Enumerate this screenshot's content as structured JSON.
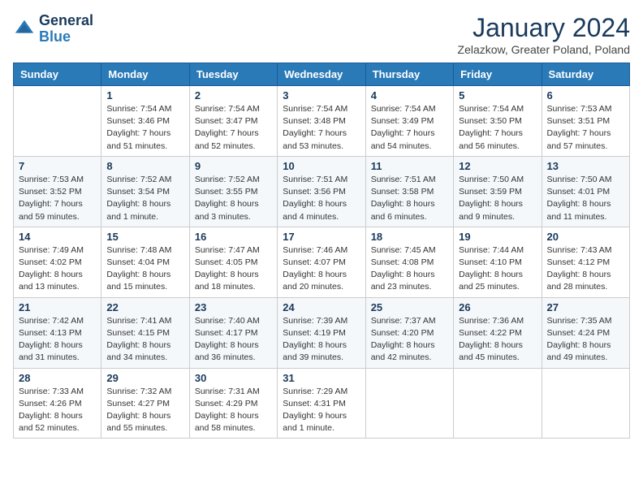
{
  "header": {
    "logo_general": "General",
    "logo_blue": "Blue",
    "month_title": "January 2024",
    "subtitle": "Zelazkow, Greater Poland, Poland"
  },
  "weekdays": [
    "Sunday",
    "Monday",
    "Tuesday",
    "Wednesday",
    "Thursday",
    "Friday",
    "Saturday"
  ],
  "weeks": [
    [
      {
        "day": null
      },
      {
        "day": 1,
        "sunrise": "7:54 AM",
        "sunset": "3:46 PM",
        "daylight": "7 hours and 51 minutes."
      },
      {
        "day": 2,
        "sunrise": "7:54 AM",
        "sunset": "3:47 PM",
        "daylight": "7 hours and 52 minutes."
      },
      {
        "day": 3,
        "sunrise": "7:54 AM",
        "sunset": "3:48 PM",
        "daylight": "7 hours and 53 minutes."
      },
      {
        "day": 4,
        "sunrise": "7:54 AM",
        "sunset": "3:49 PM",
        "daylight": "7 hours and 54 minutes."
      },
      {
        "day": 5,
        "sunrise": "7:54 AM",
        "sunset": "3:50 PM",
        "daylight": "7 hours and 56 minutes."
      },
      {
        "day": 6,
        "sunrise": "7:53 AM",
        "sunset": "3:51 PM",
        "daylight": "7 hours and 57 minutes."
      }
    ],
    [
      {
        "day": 7,
        "sunrise": "7:53 AM",
        "sunset": "3:52 PM",
        "daylight": "7 hours and 59 minutes."
      },
      {
        "day": 8,
        "sunrise": "7:52 AM",
        "sunset": "3:54 PM",
        "daylight": "8 hours and 1 minute."
      },
      {
        "day": 9,
        "sunrise": "7:52 AM",
        "sunset": "3:55 PM",
        "daylight": "8 hours and 3 minutes."
      },
      {
        "day": 10,
        "sunrise": "7:51 AM",
        "sunset": "3:56 PM",
        "daylight": "8 hours and 4 minutes."
      },
      {
        "day": 11,
        "sunrise": "7:51 AM",
        "sunset": "3:58 PM",
        "daylight": "8 hours and 6 minutes."
      },
      {
        "day": 12,
        "sunrise": "7:50 AM",
        "sunset": "3:59 PM",
        "daylight": "8 hours and 9 minutes."
      },
      {
        "day": 13,
        "sunrise": "7:50 AM",
        "sunset": "4:01 PM",
        "daylight": "8 hours and 11 minutes."
      }
    ],
    [
      {
        "day": 14,
        "sunrise": "7:49 AM",
        "sunset": "4:02 PM",
        "daylight": "8 hours and 13 minutes."
      },
      {
        "day": 15,
        "sunrise": "7:48 AM",
        "sunset": "4:04 PM",
        "daylight": "8 hours and 15 minutes."
      },
      {
        "day": 16,
        "sunrise": "7:47 AM",
        "sunset": "4:05 PM",
        "daylight": "8 hours and 18 minutes."
      },
      {
        "day": 17,
        "sunrise": "7:46 AM",
        "sunset": "4:07 PM",
        "daylight": "8 hours and 20 minutes."
      },
      {
        "day": 18,
        "sunrise": "7:45 AM",
        "sunset": "4:08 PM",
        "daylight": "8 hours and 23 minutes."
      },
      {
        "day": 19,
        "sunrise": "7:44 AM",
        "sunset": "4:10 PM",
        "daylight": "8 hours and 25 minutes."
      },
      {
        "day": 20,
        "sunrise": "7:43 AM",
        "sunset": "4:12 PM",
        "daylight": "8 hours and 28 minutes."
      }
    ],
    [
      {
        "day": 21,
        "sunrise": "7:42 AM",
        "sunset": "4:13 PM",
        "daylight": "8 hours and 31 minutes."
      },
      {
        "day": 22,
        "sunrise": "7:41 AM",
        "sunset": "4:15 PM",
        "daylight": "8 hours and 34 minutes."
      },
      {
        "day": 23,
        "sunrise": "7:40 AM",
        "sunset": "4:17 PM",
        "daylight": "8 hours and 36 minutes."
      },
      {
        "day": 24,
        "sunrise": "7:39 AM",
        "sunset": "4:19 PM",
        "daylight": "8 hours and 39 minutes."
      },
      {
        "day": 25,
        "sunrise": "7:37 AM",
        "sunset": "4:20 PM",
        "daylight": "8 hours and 42 minutes."
      },
      {
        "day": 26,
        "sunrise": "7:36 AM",
        "sunset": "4:22 PM",
        "daylight": "8 hours and 45 minutes."
      },
      {
        "day": 27,
        "sunrise": "7:35 AM",
        "sunset": "4:24 PM",
        "daylight": "8 hours and 49 minutes."
      }
    ],
    [
      {
        "day": 28,
        "sunrise": "7:33 AM",
        "sunset": "4:26 PM",
        "daylight": "8 hours and 52 minutes."
      },
      {
        "day": 29,
        "sunrise": "7:32 AM",
        "sunset": "4:27 PM",
        "daylight": "8 hours and 55 minutes."
      },
      {
        "day": 30,
        "sunrise": "7:31 AM",
        "sunset": "4:29 PM",
        "daylight": "8 hours and 58 minutes."
      },
      {
        "day": 31,
        "sunrise": "7:29 AM",
        "sunset": "4:31 PM",
        "daylight": "9 hours and 1 minute."
      },
      {
        "day": null
      },
      {
        "day": null
      },
      {
        "day": null
      }
    ]
  ]
}
